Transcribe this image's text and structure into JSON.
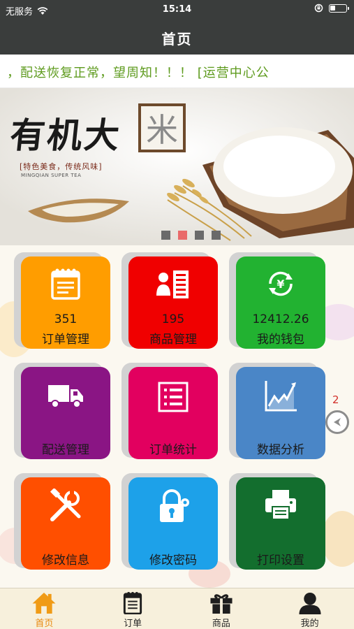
{
  "status_bar": {
    "carrier": "无服务",
    "time": "15:14"
  },
  "nav": {
    "title": "首页"
  },
  "notice": {
    "text": "，配送恢复正常，望周知！！！  [运营中心公"
  },
  "banner": {
    "headline": "有机大",
    "boxed_char": "米",
    "slogan": "[特色美食，传统风味]",
    "subline": "MINGQIAN SUPER TEA",
    "slide_count": 4,
    "active_slide": 2
  },
  "tiles": [
    {
      "id": "orders",
      "label": "订单管理",
      "value": "351",
      "color": "#ff9d00",
      "icon": "order-list-icon"
    },
    {
      "id": "goods",
      "label": "商品管理",
      "value": "195",
      "color": "#f00000",
      "icon": "goods-list-icon"
    },
    {
      "id": "wallet",
      "label": "我的钱包",
      "value": "12412.26",
      "color": "#22b231",
      "icon": "yuan-refresh-icon"
    },
    {
      "id": "delivery",
      "label": "配送管理",
      "value": "",
      "color": "#8a1584",
      "icon": "truck-icon"
    },
    {
      "id": "order_stats",
      "label": "订单统计",
      "value": "",
      "color": "#e2005f",
      "icon": "checklist-icon"
    },
    {
      "id": "analysis",
      "label": "数据分析",
      "value": "",
      "color": "#4a86c7",
      "icon": "line-chart-icon"
    },
    {
      "id": "edit_info",
      "label": "修改信息",
      "value": "",
      "color": "#ff4f00",
      "icon": "tools-icon"
    },
    {
      "id": "edit_password",
      "label": "修改密码",
      "value": "",
      "color": "#1da1e9",
      "icon": "lock-gear-icon"
    },
    {
      "id": "print_settings",
      "label": "打印设置",
      "value": "",
      "color": "#136e2e",
      "icon": "printer-icon"
    }
  ],
  "side_control": {
    "badge": "2"
  },
  "tabbar": {
    "items": [
      {
        "label": "首页",
        "icon": "home-icon",
        "active": true
      },
      {
        "label": "订单",
        "icon": "notepad-icon",
        "active": false
      },
      {
        "label": "商品",
        "icon": "gift-icon",
        "active": false
      },
      {
        "label": "我的",
        "icon": "user-icon",
        "active": false
      }
    ]
  }
}
